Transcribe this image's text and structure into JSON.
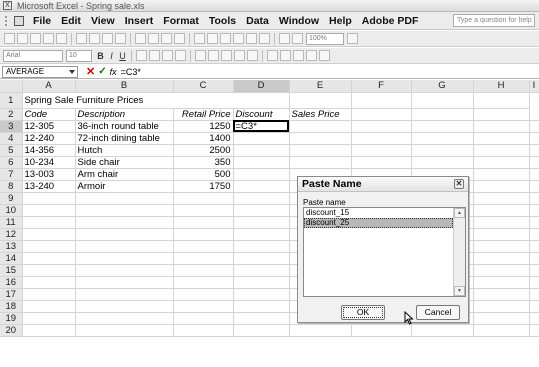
{
  "window": {
    "title": "Microsoft Excel - Spring sale.xls"
  },
  "menu": {
    "items": [
      "File",
      "Edit",
      "View",
      "Insert",
      "Format",
      "Tools",
      "Data",
      "Window",
      "Help",
      "Adobe PDF"
    ],
    "ask_placeholder": "Type a question for help"
  },
  "toolbar": {
    "zoom": "100%",
    "font_name": "Arial",
    "font_size": "10",
    "bold": "B",
    "italic": "I",
    "underline": "U"
  },
  "formula_bar": {
    "name_box": "AVERAGE",
    "fx": "fx",
    "content": "=C3*"
  },
  "sheet": {
    "columns": [
      "A",
      "B",
      "C",
      "D",
      "E",
      "F",
      "G",
      "H",
      "I"
    ],
    "title": "Spring Sale Furniture Prices",
    "headers": {
      "code": "Code",
      "description": "Description",
      "retail": "Retail Price",
      "discount": "Discount",
      "sales": "Sales Price"
    },
    "rows": [
      {
        "code": "12-305",
        "description": "36-inch round table",
        "price": "1250",
        "discount": "=C3*"
      },
      {
        "code": "12-240",
        "description": "72-inch dining table",
        "price": "1400",
        "discount": ""
      },
      {
        "code": "14-356",
        "description": "Hutch",
        "price": "2500",
        "discount": ""
      },
      {
        "code": "10-234",
        "description": "Side chair",
        "price": "350",
        "discount": ""
      },
      {
        "code": "13-003",
        "description": "Arm chair",
        "price": "500",
        "discount": ""
      },
      {
        "code": "13-240",
        "description": "Armoir",
        "price": "1750",
        "discount": ""
      }
    ],
    "row_numbers": [
      "1",
      "2",
      "3",
      "4",
      "5",
      "6",
      "7",
      "8",
      "9",
      "10",
      "11",
      "12",
      "13",
      "14",
      "15",
      "16",
      "17",
      "18",
      "19",
      "20"
    ],
    "active_cell": "D3"
  },
  "dialog": {
    "title": "Paste Name",
    "label": "Paste name",
    "items": [
      "discount_15",
      "discount_25"
    ],
    "selected_index": 1,
    "ok": "OK",
    "cancel": "Cancel"
  }
}
